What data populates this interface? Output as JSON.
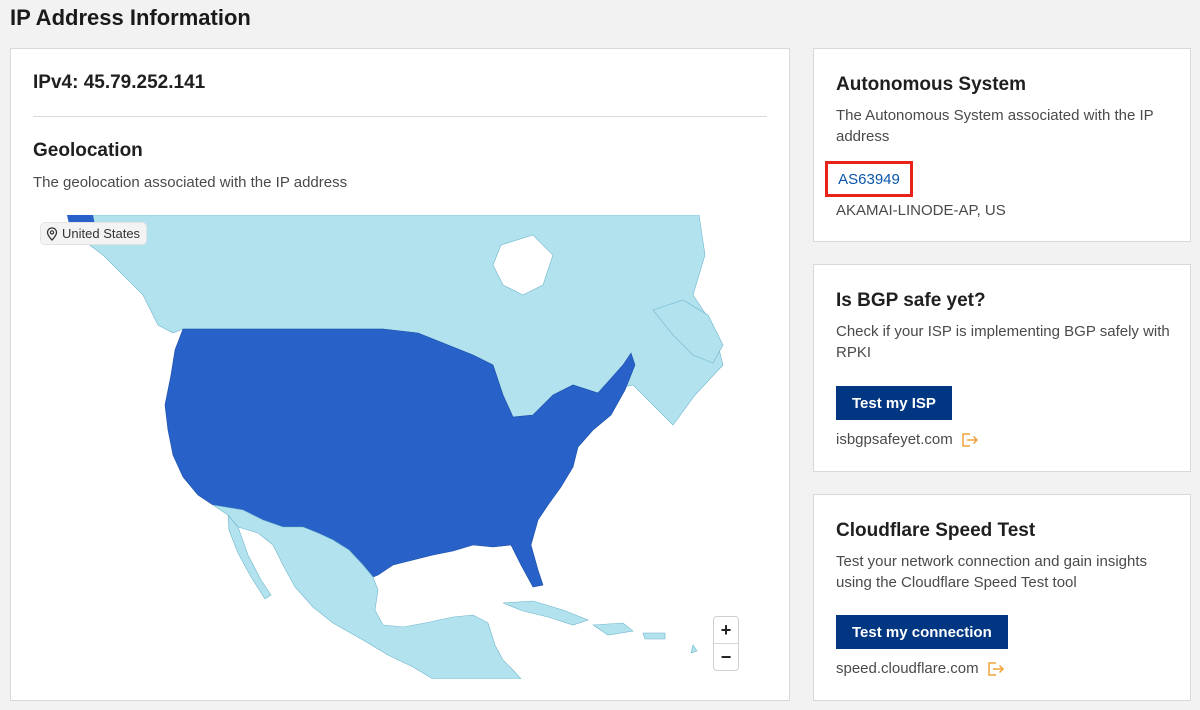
{
  "page": {
    "title": "IP Address Information"
  },
  "main": {
    "ip_label": "IPv4: 45.79.252.141",
    "geolocation": {
      "title": "Geolocation",
      "description": "The geolocation associated with the IP address",
      "location_badge": "United States",
      "zoom_in": "+",
      "zoom_out": "−",
      "colors": {
        "highlight": "#2862c9",
        "other_land": "#b3e2ef",
        "water": "#ffffff",
        "border": "#6fb6cc"
      }
    }
  },
  "autonomous_system": {
    "title": "Autonomous System",
    "description": "The Autonomous System associated with the IP address",
    "asn": "AS63949",
    "organization": "AKAMAI-LINODE-AP, US"
  },
  "bgp": {
    "title": "Is BGP safe yet?",
    "description": "Check if your ISP is implementing BGP safely with RPKI",
    "button_label": "Test my ISP",
    "link_text": "isbgpsafeyet.com",
    "link_icon": "external-link-icon"
  },
  "speed_test": {
    "title": "Cloudflare Speed Test",
    "description": "Test your network connection and gain insights using the Cloudflare Speed Test tool",
    "button_label": "Test my connection",
    "link_text": "speed.cloudflare.com",
    "link_icon": "external-link-icon"
  },
  "colors": {
    "button_bg": "#003682",
    "link": "#0b55a8",
    "highlight_box": "#e8231a",
    "external_icon": "#f0a23a"
  }
}
